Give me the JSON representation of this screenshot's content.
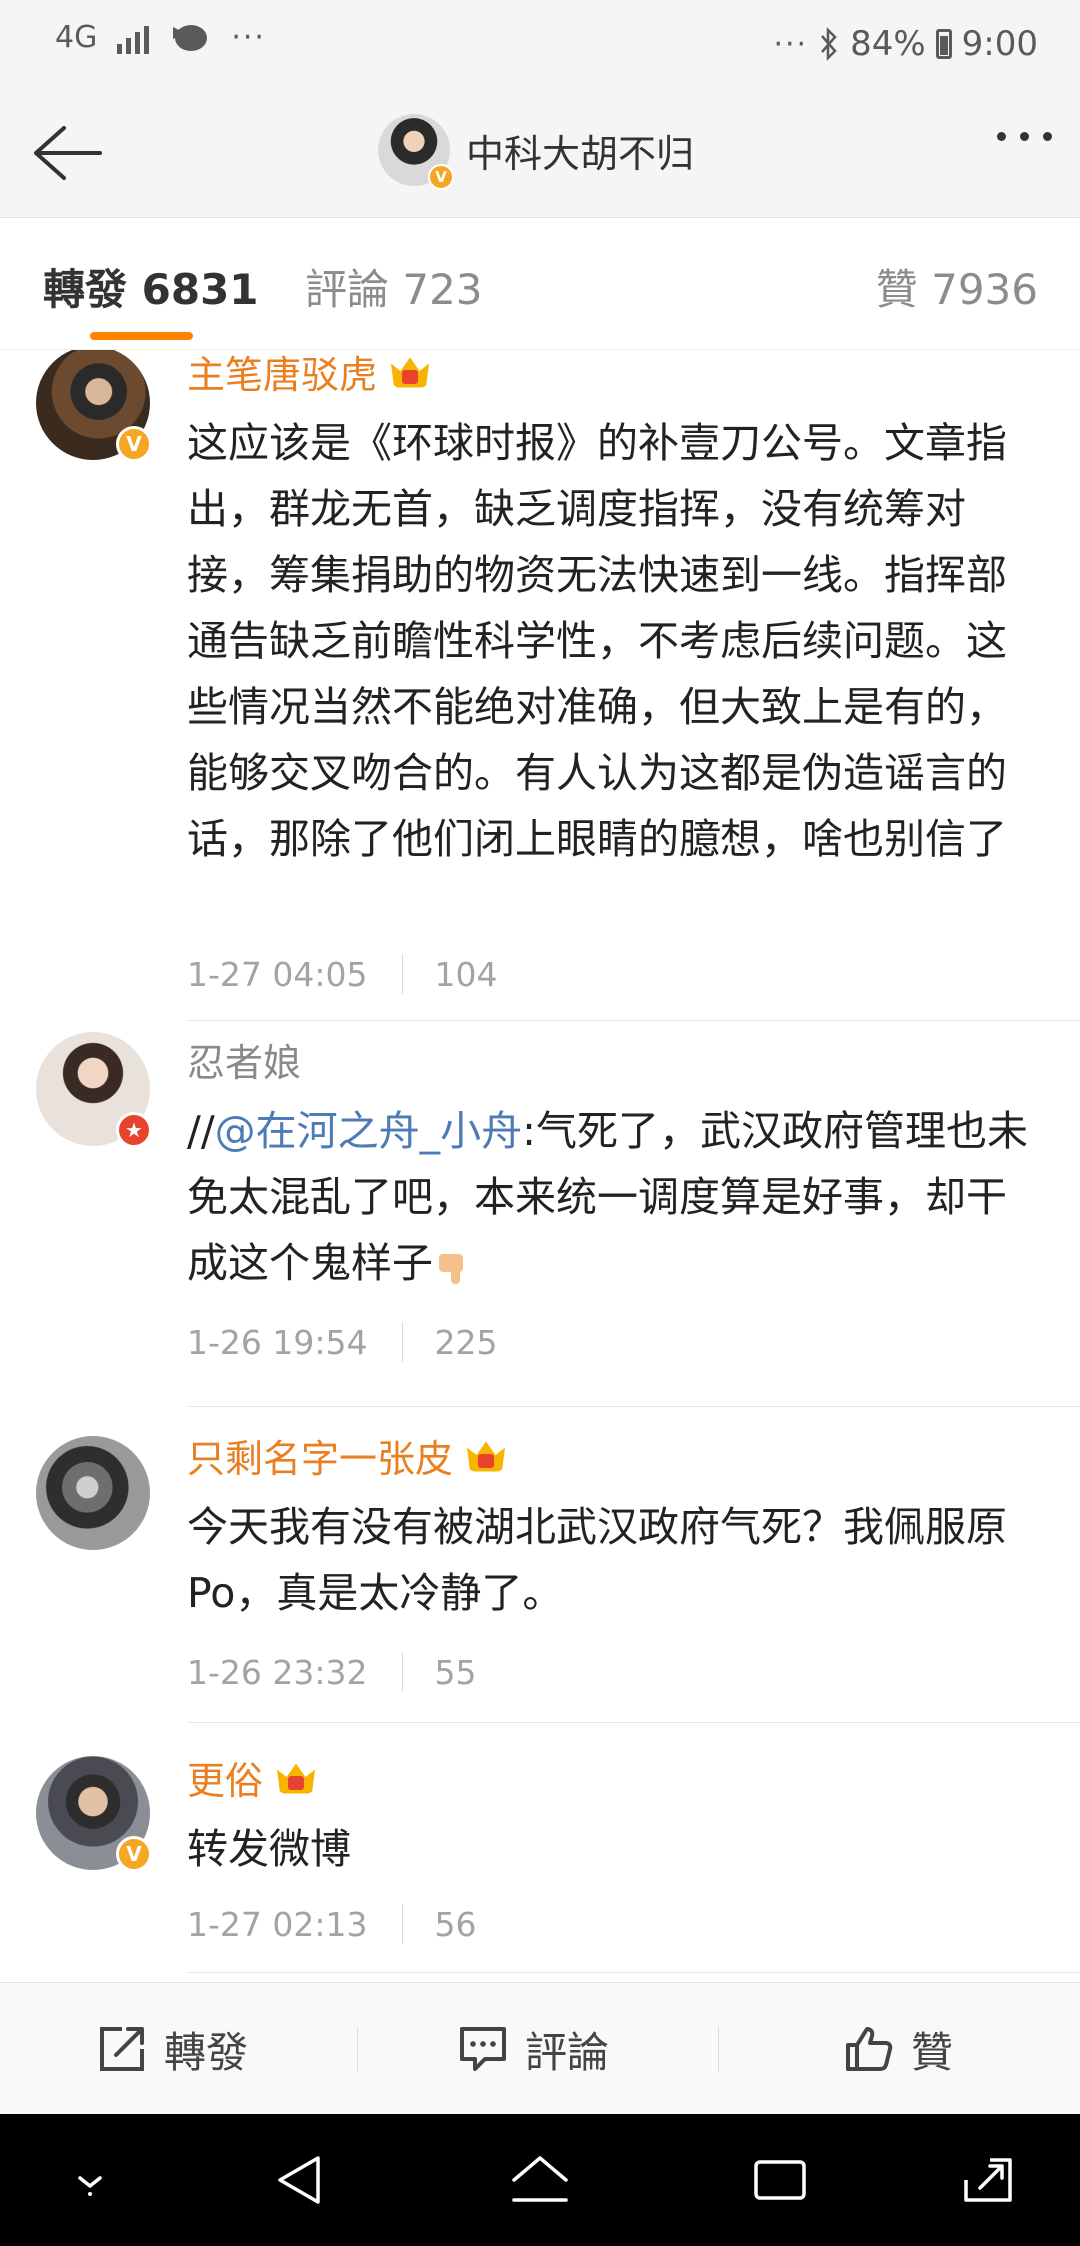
{
  "status_bar": {
    "network": "4G",
    "dots_left": "···",
    "dots_right": "···",
    "battery": "84%",
    "time": "9:00"
  },
  "header": {
    "title": "中科大胡不归",
    "verified_icon": "verified-v-icon"
  },
  "tabs": {
    "repost": "轉發 6831",
    "comment": "評論 723",
    "like": "贊 7936"
  },
  "colors": {
    "accent": "#ff8200",
    "username_vip": "#ea7f20",
    "mention": "#4d7bb5",
    "meta": "#a3a3a3"
  },
  "feed": [
    {
      "username": "主笔唐驳虎",
      "vip": true,
      "badge": "V",
      "text": "这应该是《环球时报》的补壹刀公号。文章指出，群龙无首，缺乏调度指挥，没有统筹对接，筹集捐助的物资无法快速到一线。指挥部通告缺乏前瞻性科学性，不考虑后续问题。这些情况当然不能绝对准确，但大致上是有的，能够交叉吻合的。有人认为这都是伪造谣言的话，那除了他们闭上眼睛的臆想，啥也别信了",
      "time": "1-27 04:05",
      "likes": "104"
    },
    {
      "username": "忍者娘",
      "vip": false,
      "badge": "★",
      "prefix": "//",
      "mention": "@在河之舟_小舟",
      "text": ":气死了，武汉政府管理也未免太混乱了吧，本来统一调度算是好事，却干成这个鬼样子",
      "emoji": "thumbs-down-emoji",
      "time": "1-26 19:54",
      "likes": "225"
    },
    {
      "username": "只剩名字一张皮",
      "vip": true,
      "text": "今天我有没有被湖北武汉政府气死？我佩服原Po，真是太冷静了。",
      "time": "1-26 23:32",
      "likes": "55"
    },
    {
      "username": "更俗",
      "vip": true,
      "badge": "V",
      "text": "转发微博",
      "time": "1-27 02:13",
      "likes": "56"
    }
  ],
  "action_bar": {
    "repost": "轉發",
    "comment": "評論",
    "like": "贊"
  }
}
